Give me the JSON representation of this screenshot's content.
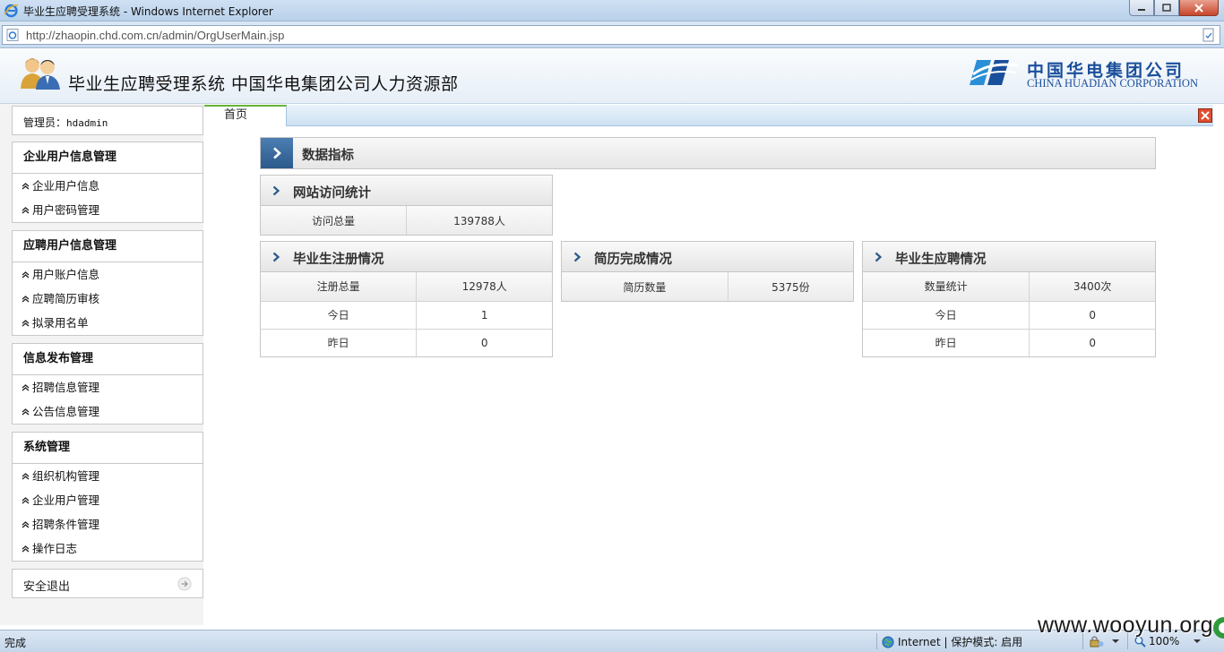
{
  "window": {
    "title": "毕业生应聘受理系统 - Windows Internet Explorer",
    "url": "http://zhaopin.chd.com.cn/admin/OrgUserMain.jsp"
  },
  "header": {
    "system_title": "毕业生应聘受理系统  中国华电集团公司人力资源部",
    "brand_cn": "中国华电集团公司",
    "brand_en": "CHINA HUADIAN CORPORATION"
  },
  "sidebar": {
    "admin_label": "管理员：",
    "admin_name": "hdadmin",
    "groups": [
      {
        "title": "企业用户信息管理",
        "items": [
          "企业用户信息",
          "用户密码管理"
        ]
      },
      {
        "title": "应聘用户信息管理",
        "items": [
          "用户账户信息",
          "应聘简历审核",
          "拟录用名单"
        ]
      },
      {
        "title": "信息发布管理",
        "items": [
          "招聘信息管理",
          "公告信息管理"
        ]
      },
      {
        "title": "系统管理",
        "items": [
          "组织机构管理",
          "企业用户管理",
          "招聘条件管理",
          "操作日志"
        ]
      }
    ],
    "logout_label": "安全退出"
  },
  "tabs": {
    "home_label": "首页"
  },
  "main": {
    "section_title": "数据指标",
    "visits": {
      "title": "网站访问统计",
      "rows": [
        [
          "访问总量",
          "139788人"
        ]
      ]
    },
    "registration": {
      "title": "毕业生注册情况",
      "rows": [
        [
          "注册总量",
          "12978人"
        ],
        [
          "今日",
          "1"
        ],
        [
          "昨日",
          "0"
        ]
      ]
    },
    "resume": {
      "title": "简历完成情况",
      "rows": [
        [
          "简历数量",
          "5375份"
        ]
      ]
    },
    "applications": {
      "title": "毕业生应聘情况",
      "rows": [
        [
          "数量统计",
          "3400次"
        ],
        [
          "今日",
          "0"
        ],
        [
          "昨日",
          "0"
        ]
      ]
    }
  },
  "statusbar": {
    "status": "完成",
    "zone": "Internet | 保护模式: 启用",
    "zoom": "100%"
  },
  "watermark": "www.wooyun.org",
  "colors": {
    "accent_blue": "#2b5a8c",
    "brand_blue": "#1a4f9b",
    "tab_green": "#66b23a"
  }
}
